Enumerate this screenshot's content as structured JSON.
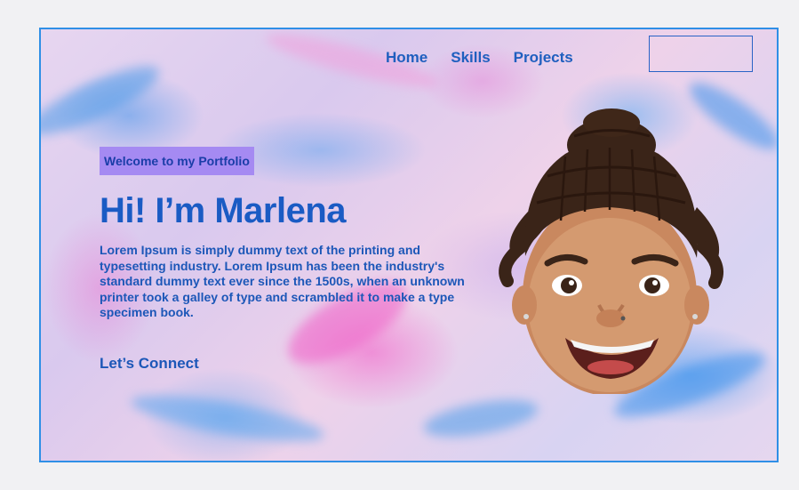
{
  "nav": {
    "items": [
      {
        "label": "Home"
      },
      {
        "label": "Skills"
      },
      {
        "label": "Projects"
      }
    ],
    "button_label": ""
  },
  "hero": {
    "badge": "Welcome to my Portfolio",
    "title": "Hi! I’m Marlena",
    "description": "Lorem Ipsum is simply dummy text of the printing and typesetting industry. Lorem Ipsum has been the industry's standard dummy text ever since the 1500s, when an unknown printer took a galley of type and scrambled it to make a type specimen book.",
    "cta": "Let’s Connect"
  },
  "colors": {
    "accent": "#1a5bc4",
    "badge_bg": "#a58af2",
    "frame_border": "#2f8fe6"
  },
  "icons": {
    "avatar": "memoji-avatar"
  }
}
